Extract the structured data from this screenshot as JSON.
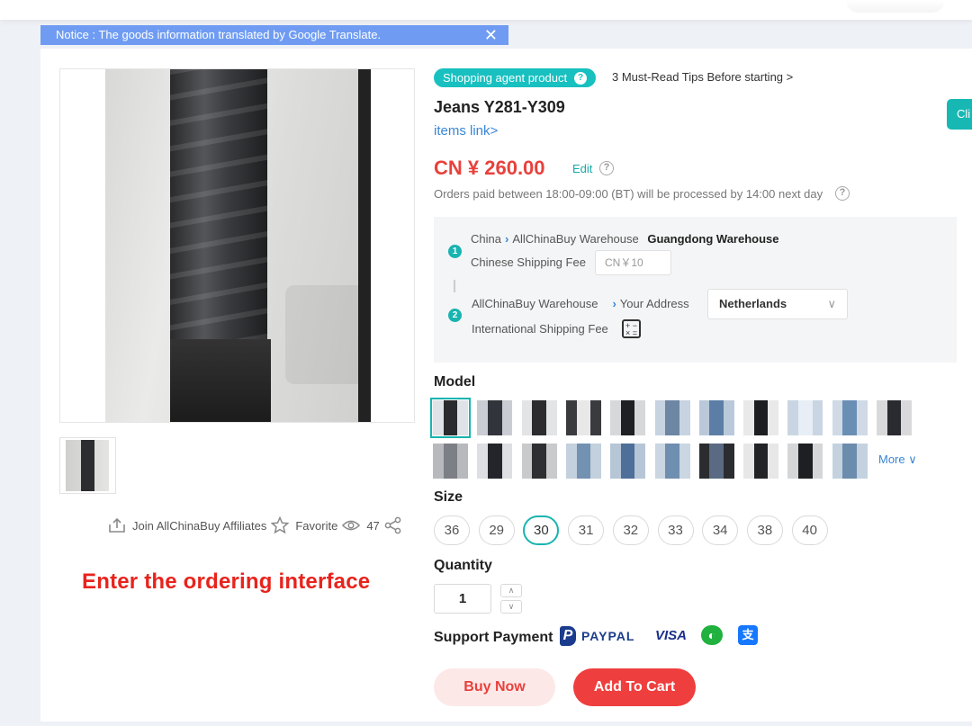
{
  "notice": {
    "text": "Notice : The goods information translated by Google Translate.",
    "close": "✕"
  },
  "badge": {
    "label": "Shopping agent product",
    "help": "?"
  },
  "tips_link": "3 Must-Read Tips Before starting >",
  "product": {
    "title": "Jeans Y281-Y309",
    "items_link": "items link>"
  },
  "side_tab": "Cli",
  "price": {
    "text": "CN ¥ 260.00",
    "edit": "Edit",
    "help": "?"
  },
  "orders_note": "Orders paid between 18:00-09:00 (BT) will be processed by 14:00 next day",
  "shipping": {
    "step1": {
      "num": "1",
      "from": "China",
      "mid": "AllChinaBuy Warehouse",
      "to": "Guangdong Warehouse",
      "fee_label": "Chinese Shipping Fee",
      "fee_value": "CN￥10"
    },
    "step2": {
      "num": "2",
      "from": "AllChinaBuy Warehouse",
      "to": "Your Address",
      "country": "Netherlands",
      "fee_label": "International Shipping Fee",
      "calc_icon": "calculator-icon"
    }
  },
  "model": {
    "label": "Model",
    "more": "More ∨",
    "swatches": [
      {
        "bg": "#dfe3e7",
        "fg": "#2a2b2e"
      },
      {
        "bg": "#c9ccd2",
        "fg": "#31343a"
      },
      {
        "bg": "#e3e4e6",
        "fg": "#2c2c2e"
      },
      {
        "bg": "#3a3b3f",
        "fg": "#e8e8e8"
      },
      {
        "bg": "#d7d8da",
        "fg": "#1f2023"
      },
      {
        "bg": "#c7d3e0",
        "fg": "#6d86a3"
      },
      {
        "bg": "#b9c9da",
        "fg": "#5c7ea6"
      },
      {
        "bg": "#e9e9e9",
        "fg": "#1d1e22"
      },
      {
        "bg": "#c9d5e2",
        "fg": "#e8eef5"
      },
      {
        "bg": "#cfdae6",
        "fg": "#6a8fb5"
      },
      {
        "bg": "#d9d9db",
        "fg": "#2a2b30"
      },
      {
        "bg": "#b7b9bd",
        "fg": "#7c7f85"
      },
      {
        "bg": "#dedfe2",
        "fg": "#23252a"
      },
      {
        "bg": "#c8cacc",
        "fg": "#2d2f33"
      },
      {
        "bg": "#c3d0dd",
        "fg": "#7392b2"
      },
      {
        "bg": "#b6c6d7",
        "fg": "#4d6f99"
      },
      {
        "bg": "#cad6e2",
        "fg": "#6f8fb0"
      },
      {
        "bg": "#2b2c30",
        "fg": "#5b6a83"
      },
      {
        "bg": "#e7e7e8",
        "fg": "#222327"
      },
      {
        "bg": "#d5d6d8",
        "fg": "#1e1f22"
      },
      {
        "bg": "#c4d2df",
        "fg": "#6c8cae"
      }
    ]
  },
  "size": {
    "label": "Size",
    "options": [
      "36",
      "29",
      "30",
      "31",
      "32",
      "33",
      "34",
      "38",
      "40"
    ],
    "selected": "30"
  },
  "quantity": {
    "label": "Quantity",
    "value": "1",
    "up": "∧",
    "down": "∨"
  },
  "payment": {
    "label": "Support Payment",
    "paypal": "PAYPAL",
    "paypal_p": "P",
    "visa": "VISA",
    "wechat": "◐",
    "alipay": "支"
  },
  "buttons": {
    "buy_now": "Buy Now",
    "add_to_cart": "Add To Cart"
  },
  "affiliate": {
    "join": "Join AllChinaBuy Affiliates",
    "favorite": "Favorite",
    "views": "47"
  },
  "caption": "Enter the ordering interface"
}
